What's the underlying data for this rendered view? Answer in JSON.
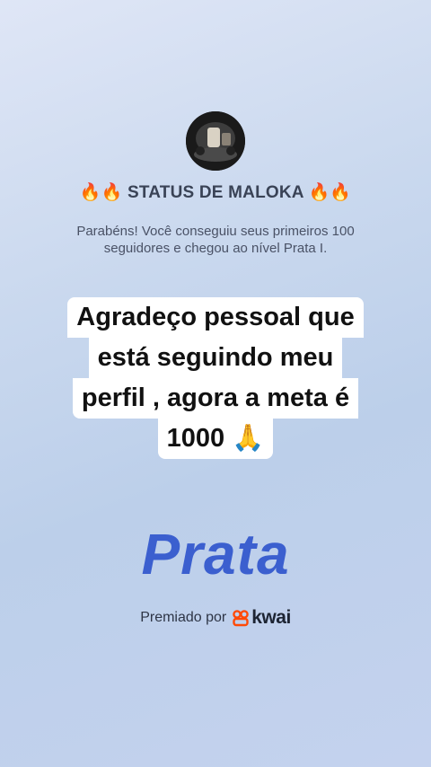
{
  "profile": {
    "name": "🔥🔥 STATUS DE MALOKA 🔥🔥",
    "avatar_icon": "profile-photo"
  },
  "notification": {
    "message": "Parabéns! Você conseguiu seus primeiros 100 seguidores e chegou ao nível Prata I."
  },
  "caption": {
    "lines": [
      "Agradeço pessoal que",
      "está seguindo meu",
      "perfil , agora a meta é",
      "1000 🙏"
    ]
  },
  "level": {
    "name": "Prata"
  },
  "award": {
    "text": "Premiado por",
    "brand": "kwai",
    "brand_color": "#ff4906"
  }
}
